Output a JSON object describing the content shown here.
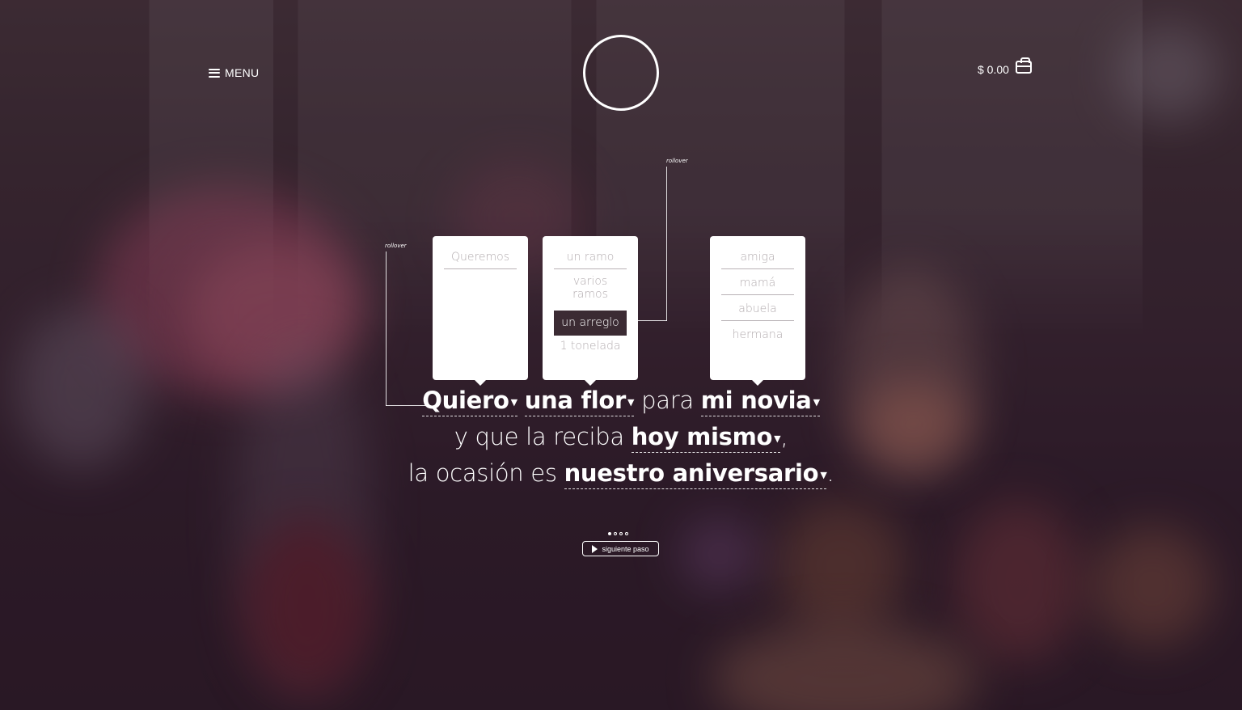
{
  "header": {
    "menu_label": "MENU",
    "cart_total": "$ 0.00"
  },
  "annotations": {
    "left": "rollover",
    "right": "rollover"
  },
  "dropdowns": {
    "verb": {
      "options": [
        "Queremos"
      ]
    },
    "item": {
      "options": [
        "un ramo",
        "varios ramos",
        "un arreglo",
        "1 tonelada"
      ],
      "selected": "un arreglo"
    },
    "recipient": {
      "options": [
        "amiga",
        "mamá",
        "abuela",
        "hermana"
      ]
    }
  },
  "sentence": {
    "verb": "Quiero",
    "item": "una flor",
    "connector_1": "para",
    "recipient": "mi novia",
    "line2_prefix": "y que la reciba",
    "when": "hoy mismo",
    "line2_suffix": ",",
    "line3_prefix": "la ocasión es",
    "occasion": "nuestro aniversario",
    "line3_suffix": ".",
    "caret": "▼"
  },
  "pager": {
    "total": 4,
    "current": 1
  },
  "next_button_label": "siguiente paso"
}
